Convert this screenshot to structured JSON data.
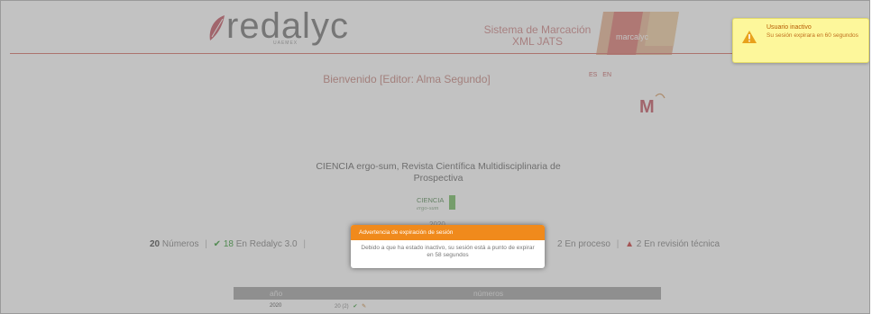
{
  "header": {
    "logo_text": "redalyc",
    "logo_sub": "UAEMEX",
    "system_title_line1": "Sistema de Marcación",
    "system_title_line2": "XML JATS",
    "badge_text": "marcalyc",
    "languages": [
      "ES",
      "EN"
    ],
    "accent_color": "#d9776e"
  },
  "welcome": "Bienvenido [Editor: Alma Segundo]",
  "journal": {
    "title": "CIENCIA ergo-sum, Revista Científica Multidisciplinaria de Prospectiva",
    "logo_text_top": "CIENCIA",
    "logo_text_bottom": "ergo-sum",
    "year": "2020"
  },
  "stats": {
    "total": "20",
    "total_label": "Números",
    "redalyc_count": "18",
    "redalyc_label": "En Redalyc 3.0",
    "process_count": "2",
    "process_label": "En proceso",
    "review_count": "2",
    "review_label": "En revisión técnica"
  },
  "table": {
    "headers": [
      "año",
      "números"
    ],
    "rows": [
      {
        "year": "2020",
        "issue": "20 (2)"
      }
    ]
  },
  "modal": {
    "title": "Advertencia de expiración de sesión",
    "message": "Debido a que ha estado inactivo, su sesión está a punto de expirar en 58 segundos",
    "header_color": "#f08a1c"
  },
  "toast": {
    "title": "Usuario inactivo",
    "message": "Su sesión expirara en 60 segundos",
    "icon": "warning-icon",
    "bg_color": "#fdf79b"
  }
}
